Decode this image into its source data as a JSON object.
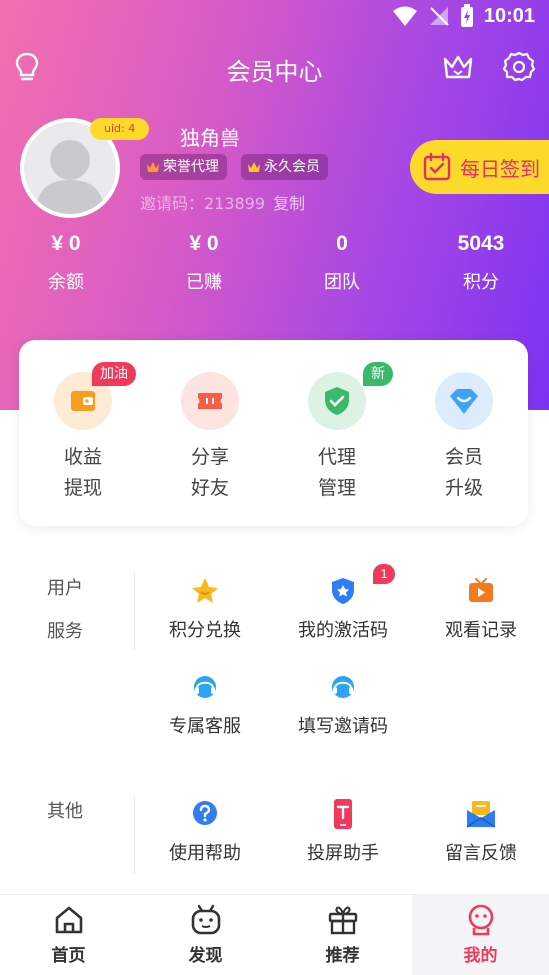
{
  "status_bar": {
    "time": "10:01"
  },
  "header": {
    "title": "会员中心"
  },
  "profile": {
    "uid_label": "uid: 4",
    "username": "独角兽",
    "tags": [
      "荣誉代理",
      "永久会员"
    ],
    "invite_label": "邀请码：213899",
    "invite_copy": "复制",
    "checkin_label": "每日签到"
  },
  "stats": [
    {
      "value": "¥ 0",
      "label": "余额"
    },
    {
      "value": "¥ 0",
      "label": "已赚"
    },
    {
      "value": "0",
      "label": "团队"
    },
    {
      "value": "5043",
      "label": "积分"
    }
  ],
  "card": {
    "items": [
      {
        "line1": "收益",
        "line2": "提现",
        "badge": "加油"
      },
      {
        "line1": "分享",
        "line2": "好友",
        "badge": ""
      },
      {
        "line1": "代理",
        "line2": "管理",
        "badge": "新"
      },
      {
        "line1": "会员",
        "line2": "升级",
        "badge": ""
      }
    ]
  },
  "user_services": {
    "title_line1": "用户",
    "title_line2": "服务",
    "items": [
      {
        "label": "积分兑换",
        "icon": "star-icon"
      },
      {
        "label": "我的激活码",
        "icon": "shield-star-icon",
        "badge": "1"
      },
      {
        "label": "观看记录",
        "icon": "tv-play-icon"
      },
      {
        "label": "专属客服",
        "icon": "headset-icon"
      },
      {
        "label": "填写邀请码",
        "icon": "headset-icon"
      }
    ]
  },
  "other": {
    "title": "其他",
    "items": [
      {
        "label": "使用帮助",
        "icon": "question-icon"
      },
      {
        "label": "投屏助手",
        "icon": "cast-phone-icon"
      },
      {
        "label": "留言反馈",
        "icon": "mail-icon"
      }
    ]
  },
  "tabs": [
    {
      "label": "首页",
      "icon": "home-icon"
    },
    {
      "label": "发现",
      "icon": "robot-icon"
    },
    {
      "label": "推荐",
      "icon": "gift-icon"
    },
    {
      "label": "我的",
      "icon": "profile-face-icon",
      "active": true
    }
  ],
  "colors": {
    "accent": "#f0395b",
    "gradient_start": "#f36fae",
    "gradient_end": "#7d33f2",
    "checkin_bg": "#fcd92b"
  }
}
